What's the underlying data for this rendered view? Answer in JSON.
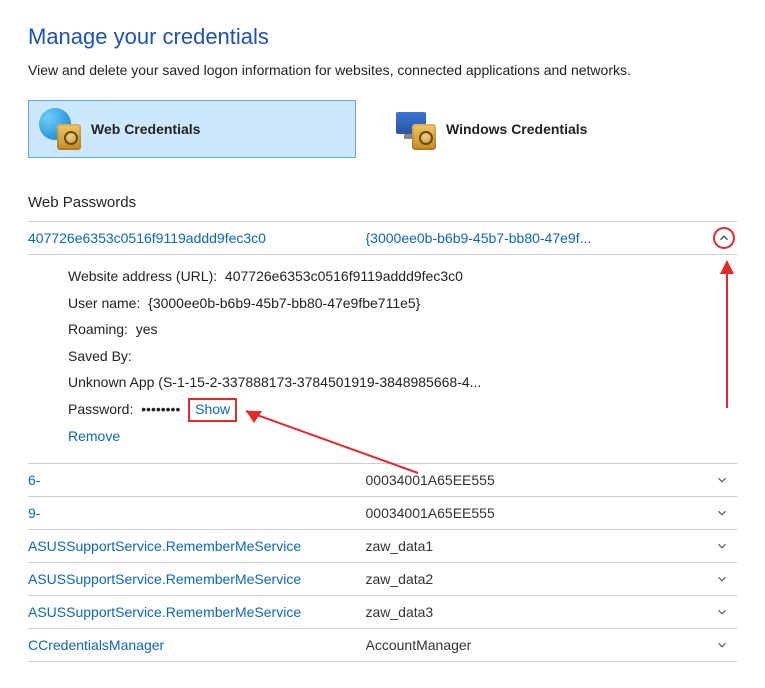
{
  "header": {
    "title": "Manage your credentials",
    "subtitle": "View and delete your saved logon information for websites, connected applications and networks."
  },
  "tabs": {
    "web": "Web Credentials",
    "windows": "Windows Credentials"
  },
  "section": "Web Passwords",
  "expanded": {
    "name": "407726e6353c0516f9119addd9fec3c0",
    "user_short": "{3000ee0b-b6b9-45b7-bb80-47e9f...",
    "url_label": "Website address (URL):",
    "url_value": "407726e6353c0516f9119addd9fec3c0",
    "username_label": "User name:",
    "username_value": "{3000ee0b-b6b9-45b7-bb80-47e9fbe711e5}",
    "roaming_label": "Roaming:",
    "roaming_value": "yes",
    "savedby_label": "Saved By:",
    "savedby_value": "Unknown App (S-1-15-2-337888173-3784501919-3848985668-4...",
    "password_label": "Password:",
    "password_mask": "••••••••",
    "show": "Show",
    "remove": "Remove"
  },
  "rows": [
    {
      "name": "6-",
      "value": "00034001A65EE555"
    },
    {
      "name": "9-",
      "value": "00034001A65EE555"
    },
    {
      "name": "ASUSSupportService.RememberMeService",
      "value": "zaw_data1"
    },
    {
      "name": "ASUSSupportService.RememberMeService",
      "value": "zaw_data2"
    },
    {
      "name": "ASUSSupportService.RememberMeService",
      "value": "zaw_data3"
    },
    {
      "name": "CCredentialsManager",
      "value": "AccountManager"
    }
  ]
}
